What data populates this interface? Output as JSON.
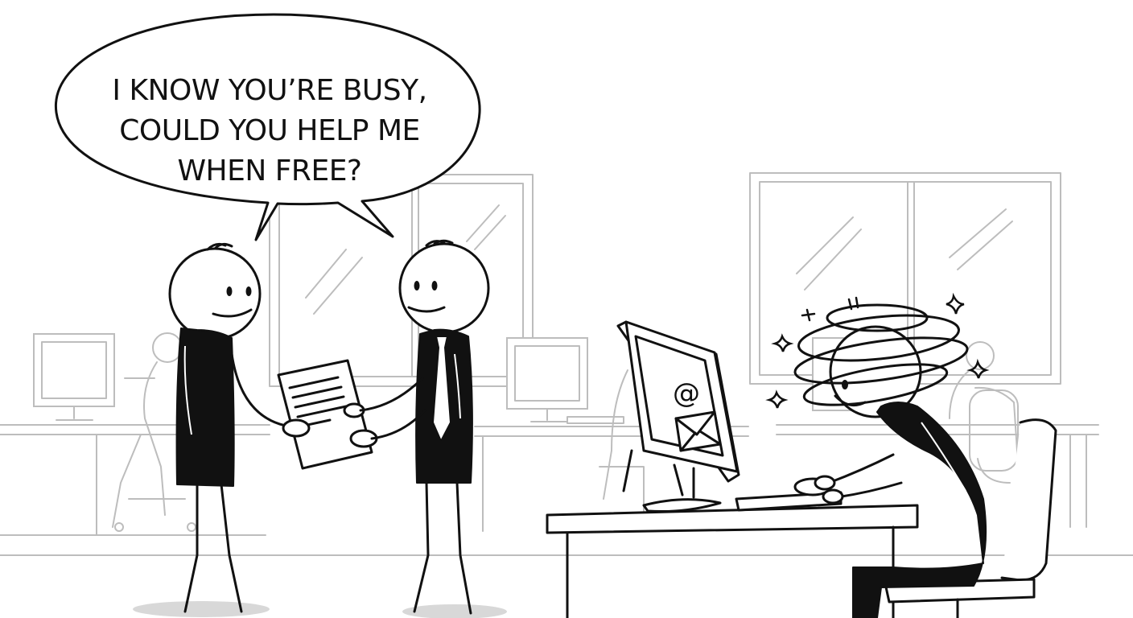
{
  "speech_bubble": {
    "lines": [
      "I KNOW YOU’RE BUSY,",
      "COULD YOU HELP ME",
      "WHEN FREE?"
    ]
  },
  "monitor_screen": {
    "at_symbol": "@"
  },
  "colors": {
    "ink": "#111111",
    "background_line": "#bdbdbd",
    "background": "#ffffff"
  },
  "icons": [
    "speech-bubble",
    "document-icon",
    "envelope-icon",
    "at-symbol-icon",
    "dizzy-stars-icon"
  ]
}
